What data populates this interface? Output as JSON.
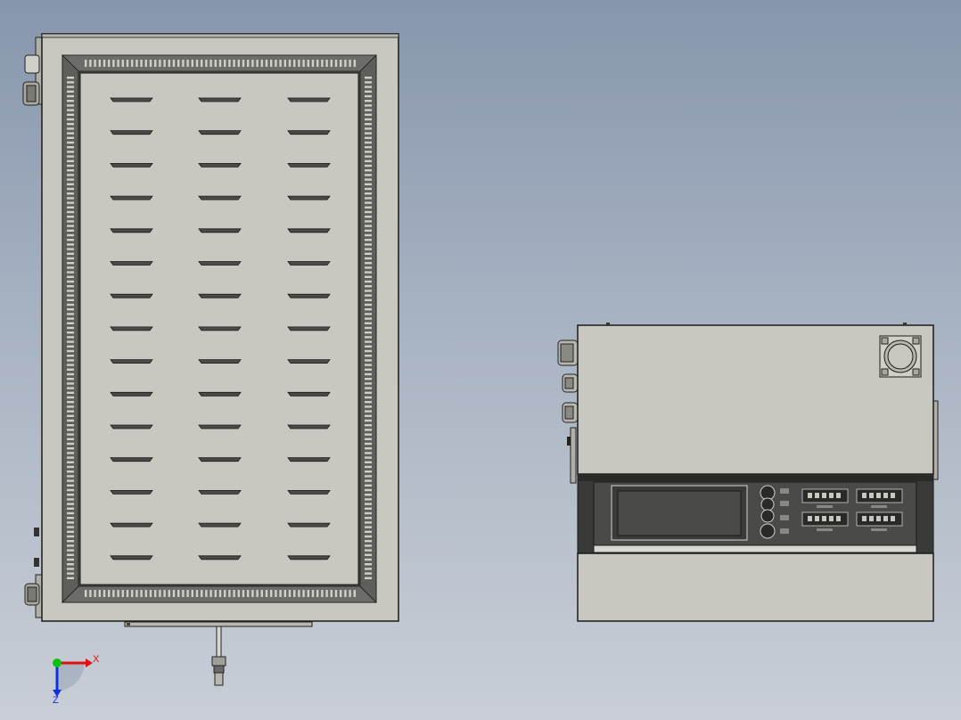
{
  "viewport": {
    "background_top": "#8796ad",
    "background_bottom": "#c9ced6"
  },
  "colors": {
    "body": "#c8c8c0",
    "outline": "#1a1a1a",
    "frame": "#5a5a58",
    "frame_dark": "#3b3b3a",
    "slot": "#2a2a2a",
    "panel": "#3a3a38",
    "screen": "#4a4a48"
  },
  "triad": {
    "x_label": "X",
    "z_label": "Z",
    "x_color": "#e01010",
    "y_color": "#10c010",
    "z_color": "#1030e0"
  },
  "views": {
    "top_view": {
      "louver_rows": 15,
      "louver_columns": 3
    },
    "front_view": {
      "connector_count": 4
    }
  }
}
